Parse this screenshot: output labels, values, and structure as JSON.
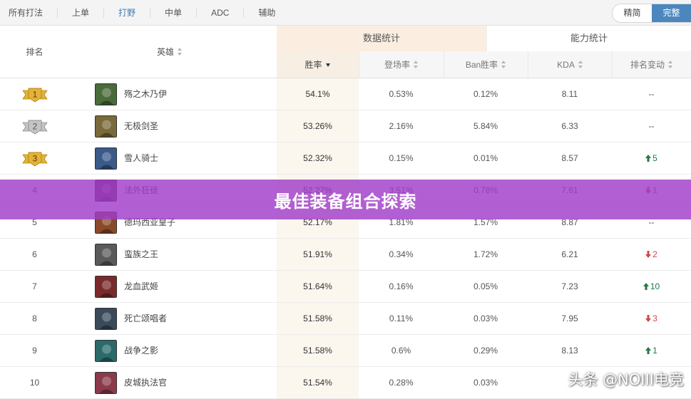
{
  "role_tabs": [
    {
      "label": "所有打法",
      "active": false
    },
    {
      "label": "上单",
      "active": false
    },
    {
      "label": "打野",
      "active": true
    },
    {
      "label": "中单",
      "active": false
    },
    {
      "label": "ADC",
      "active": false
    },
    {
      "label": "辅助",
      "active": false
    }
  ],
  "view_toggle": {
    "simple": "精简",
    "full": "完整",
    "active": "full"
  },
  "header": {
    "rank": "排名",
    "hero": "英雄",
    "group_data": "数据统计",
    "group_ability": "能力统计",
    "winrate": "胜率",
    "pickrate": "登场率",
    "banrate": "Ban胜率",
    "kda": "KDA",
    "rank_change": "排名变动"
  },
  "colors": {
    "accent": "#4b87be",
    "active_tab": "#3d7fb8",
    "rise": "#1f7a3f",
    "fall": "#d0484a",
    "banner": "#a03cc8",
    "gold_medal": "#e3b23c",
    "silver_medal": "#c4c4c4"
  },
  "rows": [
    {
      "rank": "1",
      "medal": "gold",
      "hero": "殇之木乃伊",
      "icon": "amumu-portrait",
      "avatar_color": "#4a6b3a",
      "winrate": "54.1%",
      "pickrate": "0.53%",
      "banrate": "0.12%",
      "kda": "8.11",
      "change": "--",
      "dir": "none"
    },
    {
      "rank": "2",
      "medal": "silver",
      "hero": "无极剑圣",
      "icon": "master-yi-portrait",
      "avatar_color": "#7a6a3a",
      "winrate": "53.26%",
      "pickrate": "2.16%",
      "banrate": "5.84%",
      "kda": "6.33",
      "change": "--",
      "dir": "none"
    },
    {
      "rank": "3",
      "medal": "gold",
      "hero": "雪人骑士",
      "icon": "nunu-portrait",
      "avatar_color": "#3a5a8a",
      "winrate": "52.32%",
      "pickrate": "0.15%",
      "banrate": "0.01%",
      "kda": "8.57",
      "change": "5",
      "dir": "up"
    },
    {
      "rank": "4",
      "medal": "",
      "hero": "法外狂徒",
      "icon": "graves-portrait",
      "avatar_color": "#6a3a5a",
      "winrate": "52.27%",
      "pickrate": "3.51%",
      "banrate": "0.78%",
      "kda": "7.61",
      "change": "1",
      "dir": "down"
    },
    {
      "rank": "5",
      "medal": "",
      "hero": "德玛西亚皇子",
      "icon": "jarvan-portrait",
      "avatar_color": "#8a4a2a",
      "winrate": "52.17%",
      "pickrate": "1.81%",
      "banrate": "1.57%",
      "kda": "8.87",
      "change": "--",
      "dir": "none"
    },
    {
      "rank": "6",
      "medal": "",
      "hero": "蛮族之王",
      "icon": "tryndamere-portrait",
      "avatar_color": "#5a5a5a",
      "winrate": "51.91%",
      "pickrate": "0.34%",
      "banrate": "1.72%",
      "kda": "6.21",
      "change": "2",
      "dir": "down"
    },
    {
      "rank": "7",
      "medal": "",
      "hero": "龙血武姬",
      "icon": "shyvana-portrait",
      "avatar_color": "#7a2a2a",
      "winrate": "51.64%",
      "pickrate": "0.16%",
      "banrate": "0.05%",
      "kda": "7.23",
      "change": "10",
      "dir": "up"
    },
    {
      "rank": "8",
      "medal": "",
      "hero": "死亡颂唱者",
      "icon": "karthus-portrait",
      "avatar_color": "#3a4a5a",
      "winrate": "51.58%",
      "pickrate": "0.11%",
      "banrate": "0.03%",
      "kda": "7.95",
      "change": "3",
      "dir": "down"
    },
    {
      "rank": "9",
      "medal": "",
      "hero": "战争之影",
      "icon": "hecarim-portrait",
      "avatar_color": "#2a6a6a",
      "winrate": "51.58%",
      "pickrate": "0.6%",
      "banrate": "0.29%",
      "kda": "8.13",
      "change": "1",
      "dir": "up"
    },
    {
      "rank": "10",
      "medal": "",
      "hero": "皮城执法官",
      "icon": "vi-portrait",
      "avatar_color": "#8a3a4a",
      "winrate": "51.54%",
      "pickrate": "0.28%",
      "banrate": "0.03%",
      "kda": "",
      "change": "",
      "dir": "none"
    }
  ],
  "banner": "最佳装备组合探索",
  "watermark": "头条 @NOIII电竞"
}
